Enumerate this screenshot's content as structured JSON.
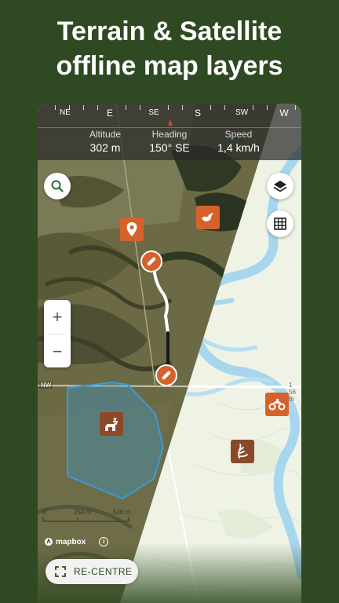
{
  "headline": {
    "line1": "Terrain & Satellite",
    "line2": "offline map layers"
  },
  "compass": {
    "labels": [
      "NE",
      "E",
      "SE",
      "S",
      "SW",
      "W"
    ],
    "heading_marker_color": "#d94030"
  },
  "stats": {
    "altitude": {
      "label": "Altitude",
      "value": "302 m"
    },
    "heading": {
      "label": "Heading",
      "value": "150° SE"
    },
    "speed": {
      "label": "Speed",
      "value": "1,4 km/h"
    }
  },
  "map": {
    "road_label_left": "NW",
    "road_label_right": "1 56 th",
    "scale": {
      "zero": "0",
      "mid": "250 m",
      "end": "500 m"
    },
    "attribution": "mapbox",
    "markers": [
      {
        "name": "location-pin",
        "icon": "map-pin-icon"
      },
      {
        "name": "bird",
        "icon": "bird-icon"
      },
      {
        "name": "atv",
        "icon": "atv-icon"
      },
      {
        "name": "deer",
        "icon": "deer-icon"
      },
      {
        "name": "antler",
        "icon": "antler-icon"
      }
    ],
    "zoom_in": "+",
    "zoom_out": "−"
  },
  "recentre": {
    "label": "RE-CENTRE"
  },
  "colors": {
    "background": "#2f4a22",
    "marker": "#d4622a",
    "marker_dark": "#8a4a2a",
    "track": "#1a1a1a",
    "hunt_area": "#3a9ad9",
    "river": "#a9d6ef"
  }
}
